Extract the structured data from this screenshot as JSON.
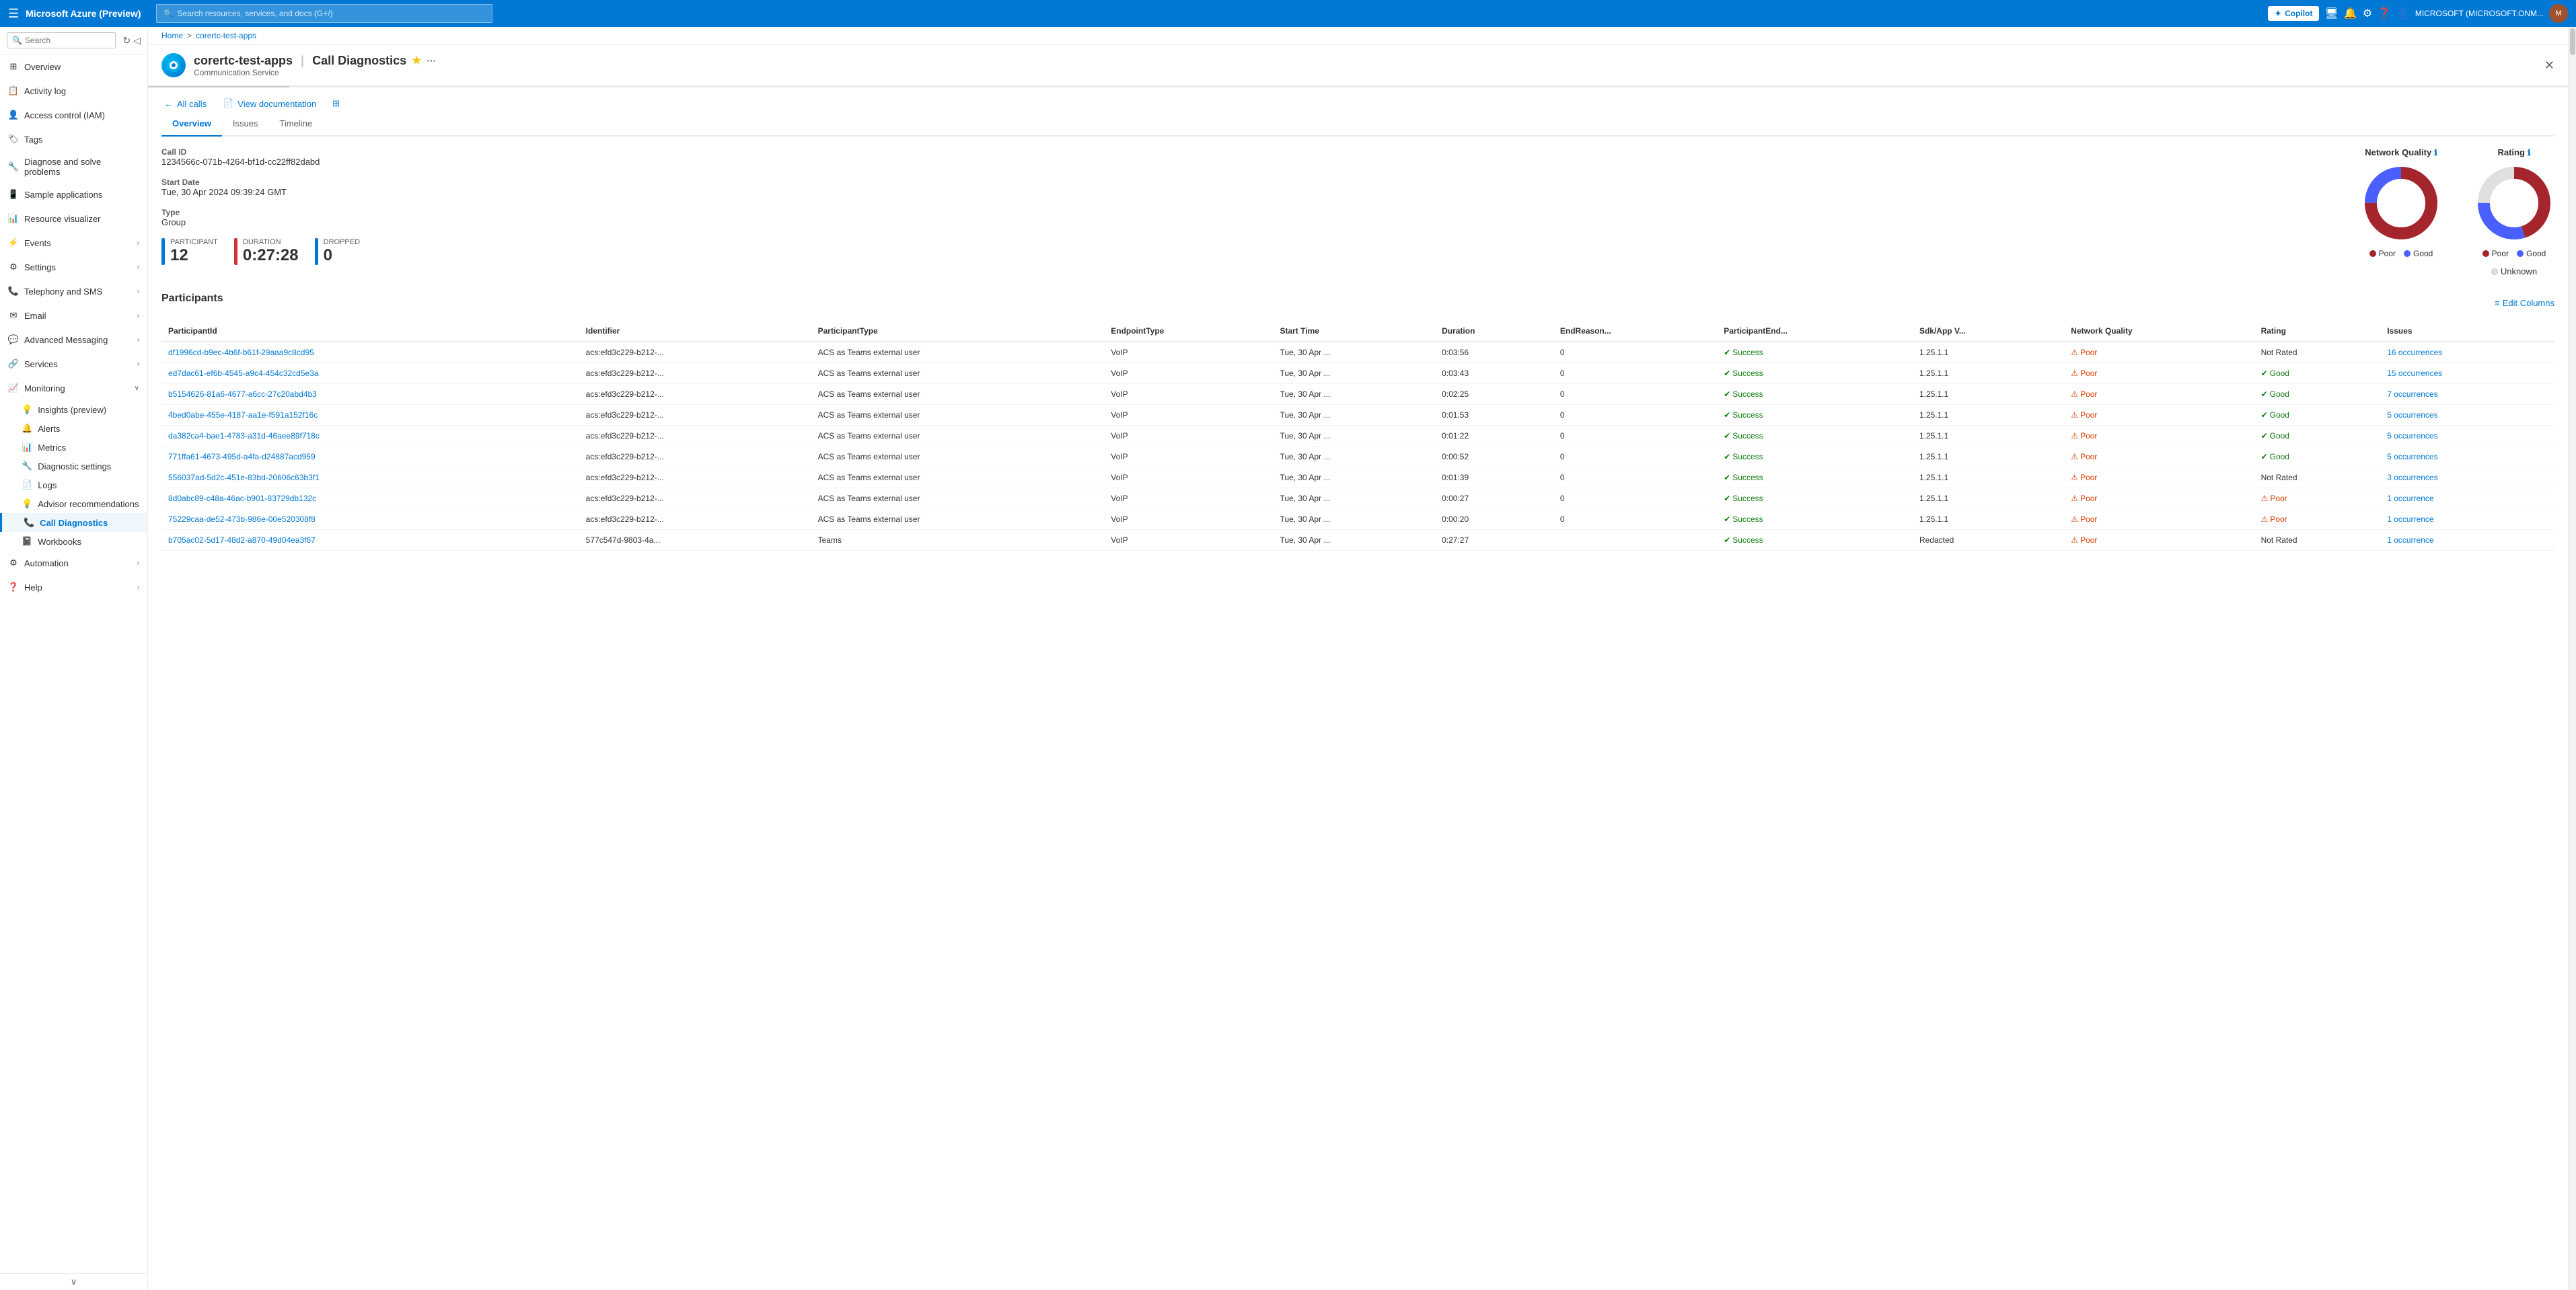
{
  "topNav": {
    "hamburger": "☰",
    "appTitle": "Microsoft Azure (Preview)",
    "searchPlaceholder": "Search resources, services, and docs (G+/)",
    "copilotLabel": "Copilot",
    "userText": "MICROSOFT (MICROSOFT.ONM...",
    "icons": [
      "monitor",
      "bell",
      "gear",
      "question",
      "person"
    ]
  },
  "breadcrumb": {
    "home": "Home",
    "separator": ">",
    "resource": "corertc-test-apps"
  },
  "resourceHeader": {
    "name": "corertc-test-apps",
    "separator": "|",
    "page": "Call Diagnostics",
    "subtitle": "Communication Service",
    "starIcon": "★",
    "moreIcon": "···"
  },
  "sidebar": {
    "searchPlaceholder": "Search",
    "items": [
      {
        "id": "overview",
        "label": "Overview",
        "icon": "⊞"
      },
      {
        "id": "activity-log",
        "label": "Activity log",
        "icon": "📋"
      },
      {
        "id": "access-control",
        "label": "Access control (IAM)",
        "icon": "👤"
      },
      {
        "id": "tags",
        "label": "Tags",
        "icon": "🏷"
      },
      {
        "id": "diagnose",
        "label": "Diagnose and solve problems",
        "icon": "🔧"
      },
      {
        "id": "sample-apps",
        "label": "Sample applications",
        "icon": "📱"
      },
      {
        "id": "resource-viz",
        "label": "Resource visualizer",
        "icon": "📊"
      },
      {
        "id": "events",
        "label": "Events",
        "icon": "⚡",
        "hasChevron": true
      },
      {
        "id": "settings",
        "label": "Settings",
        "icon": "⚙",
        "hasChevron": true
      },
      {
        "id": "telephony",
        "label": "Telephony and SMS",
        "icon": "📞",
        "hasChevron": true
      },
      {
        "id": "email",
        "label": "Email",
        "icon": "✉",
        "hasChevron": true
      },
      {
        "id": "advanced-messaging",
        "label": "Advanced Messaging",
        "icon": "💬",
        "hasChevron": true
      },
      {
        "id": "services",
        "label": "Services",
        "icon": "🔗",
        "hasChevron": true
      },
      {
        "id": "monitoring",
        "label": "Monitoring",
        "icon": "📈",
        "expanded": true
      },
      {
        "id": "insights",
        "label": "Insights (preview)",
        "icon": "💡",
        "indent": true
      },
      {
        "id": "alerts",
        "label": "Alerts",
        "icon": "🔔",
        "indent": true
      },
      {
        "id": "metrics",
        "label": "Metrics",
        "icon": "📊",
        "indent": true
      },
      {
        "id": "diagnostic-settings",
        "label": "Diagnostic settings",
        "icon": "🔧",
        "indent": true
      },
      {
        "id": "logs",
        "label": "Logs",
        "icon": "📄",
        "indent": true
      },
      {
        "id": "advisor",
        "label": "Advisor recommendations",
        "icon": "💡",
        "indent": true
      },
      {
        "id": "call-diagnostics",
        "label": "Call Diagnostics",
        "icon": "📞",
        "indent": true,
        "active": true
      },
      {
        "id": "workbooks",
        "label": "Workbooks",
        "icon": "📓",
        "indent": true
      },
      {
        "id": "automation",
        "label": "Automation",
        "icon": "⚙",
        "hasChevron": true
      },
      {
        "id": "help",
        "label": "Help",
        "icon": "❓",
        "hasChevron": true
      }
    ]
  },
  "toolbar": {
    "backLabel": "All calls",
    "docLabel": "View documentation",
    "gridIcon": "⊞"
  },
  "tabs": [
    {
      "id": "overview",
      "label": "Overview",
      "active": true
    },
    {
      "id": "issues",
      "label": "Issues"
    },
    {
      "id": "timeline",
      "label": "Timeline"
    }
  ],
  "callInfo": {
    "callIdLabel": "Call ID",
    "callIdValue": "1234566c-071b-4264-bf1d-cc22ff82dabd",
    "startDateLabel": "Start Date",
    "startDateValue": "Tue, 30 Apr 2024 09:39:24 GMT",
    "typeLabel": "Type",
    "typeValue": "Group"
  },
  "kpis": [
    {
      "id": "participant",
      "label": "Participant",
      "value": "12",
      "color": "#0078d4"
    },
    {
      "id": "duration",
      "label": "Duration",
      "value": "0:27:28",
      "color": "#d13438"
    },
    {
      "id": "dropped",
      "label": "Dropped",
      "value": "0",
      "color": "#0078d4"
    }
  ],
  "charts": {
    "networkQuality": {
      "title": "Network Quality",
      "poorValue": 75,
      "goodValue": 25,
      "poorColor": "#a4262c",
      "goodColor": "#4a5fff",
      "legend": [
        {
          "label": "Poor",
          "color": "#a4262c"
        },
        {
          "label": "Good",
          "color": "#4a5fff"
        }
      ]
    },
    "rating": {
      "title": "Rating",
      "poorValue": 45,
      "goodValue": 30,
      "unknownValue": 25,
      "poorColor": "#a4262c",
      "goodColor": "#4a5fff",
      "unknownColor": "#e0e0e0",
      "legend": [
        {
          "label": "Poor",
          "color": "#a4262c"
        },
        {
          "label": "Good",
          "color": "#4a5fff"
        },
        {
          "label": "Unknown",
          "color": "#e0e0e0"
        }
      ]
    }
  },
  "participants": {
    "sectionTitle": "Participants",
    "editColumnsLabel": "Edit Columns",
    "columns": [
      "ParticipantId",
      "Identifier",
      "ParticipantType",
      "EndpointType",
      "Start Time",
      "Duration",
      "EndReason...",
      "ParticipantEnd...",
      "Sdk/App V...",
      "Network Quality",
      "Rating",
      "Issues"
    ],
    "rows": [
      {
        "participantId": "df1996cd-b9ec-4b6f-b61f-29aaa9c8cd95",
        "identifier": "acs:efd3c229-b212-...",
        "participantType": "ACS as Teams external user",
        "endpointType": "VoIP",
        "startTime": "Tue, 30 Apr ...",
        "duration": "0:03:56",
        "endReason": "0",
        "participantEnd": "Success",
        "sdkAppV": "1.25.1.1",
        "networkQuality": "Poor",
        "rating": "Not Rated",
        "issues": "16 occurrences",
        "endSuccess": true,
        "networkPoor": true,
        "ratingNeutral": true
      },
      {
        "participantId": "ed7dac61-ef6b-4545-a9c4-454c32cd5e3a",
        "identifier": "acs:efd3c229-b212-...",
        "participantType": "ACS as Teams external user",
        "endpointType": "VoIP",
        "startTime": "Tue, 30 Apr ...",
        "duration": "0:03:43",
        "endReason": "0",
        "participantEnd": "Success",
        "sdkAppV": "1.25.1.1",
        "networkQuality": "Poor",
        "rating": "Good",
        "issues": "15 occurrences",
        "endSuccess": true,
        "networkPoor": true,
        "ratingGood": true
      },
      {
        "participantId": "b5154626-81a6-4677-a6cc-27c20abd4b3",
        "identifier": "acs:efd3c229-b212-...",
        "participantType": "ACS as Teams external user",
        "endpointType": "VoIP",
        "startTime": "Tue, 30 Apr ...",
        "duration": "0:02:25",
        "endReason": "0",
        "participantEnd": "Success",
        "sdkAppV": "1.25.1.1",
        "networkQuality": "Poor",
        "rating": "Good",
        "issues": "7 occurrences",
        "endSuccess": true,
        "networkPoor": true,
        "ratingGood": true
      },
      {
        "participantId": "4bed0abe-455e-4187-aa1e-f591a152f16c",
        "identifier": "acs:efd3c229-b212-...",
        "participantType": "ACS as Teams external user",
        "endpointType": "VoIP",
        "startTime": "Tue, 30 Apr ...",
        "duration": "0:01:53",
        "endReason": "0",
        "participantEnd": "Success",
        "sdkAppV": "1.25.1.1",
        "networkQuality": "Poor",
        "rating": "Good",
        "issues": "5 occurrences",
        "endSuccess": true,
        "networkPoor": true,
        "ratingGood": true
      },
      {
        "participantId": "da382ca4-bae1-4783-a31d-46aee89f718c",
        "identifier": "acs:efd3c229-b212-...",
        "participantType": "ACS as Teams external user",
        "endpointType": "VoIP",
        "startTime": "Tue, 30 Apr ...",
        "duration": "0:01:22",
        "endReason": "0",
        "participantEnd": "Success",
        "sdkAppV": "1.25.1.1",
        "networkQuality": "Poor",
        "rating": "Good",
        "issues": "5 occurrences",
        "endSuccess": true,
        "networkPoor": true,
        "ratingGood": true
      },
      {
        "participantId": "771ffa61-4673-495d-a4fa-d24887acd959",
        "identifier": "acs:efd3c229-b212-...",
        "participantType": "ACS as Teams external user",
        "endpointType": "VoIP",
        "startTime": "Tue, 30 Apr ...",
        "duration": "0:00:52",
        "endReason": "0",
        "participantEnd": "Success",
        "sdkAppV": "1.25.1.1",
        "networkQuality": "Poor",
        "rating": "Good",
        "issues": "5 occurrences",
        "endSuccess": true,
        "networkPoor": true,
        "ratingGood": true
      },
      {
        "participantId": "556037ad-5d2c-451e-83bd-20606c63b3f1",
        "identifier": "acs:efd3c229-b212-...",
        "participantType": "ACS as Teams external user",
        "endpointType": "VoIP",
        "startTime": "Tue, 30 Apr ...",
        "duration": "0:01:39",
        "endReason": "0",
        "participantEnd": "Success",
        "sdkAppV": "1.25.1.1",
        "networkQuality": "Poor",
        "rating": "Not Rated",
        "issues": "3 occurrences",
        "endSuccess": true,
        "networkPoor": true,
        "ratingNeutral": true
      },
      {
        "participantId": "8d0abc89-c48a-46ac-b901-83729db132c",
        "identifier": "acs:efd3c229-b212-...",
        "participantType": "ACS as Teams external user",
        "endpointType": "VoIP",
        "startTime": "Tue, 30 Apr ...",
        "duration": "0:00:27",
        "endReason": "0",
        "participantEnd": "Success",
        "sdkAppV": "1.25.1.1",
        "networkQuality": "Poor",
        "rating": "Poor",
        "issues": "1 occurrence",
        "endSuccess": true,
        "networkPoor": true,
        "ratingPoor": true
      },
      {
        "participantId": "75229caa-de52-473b-986e-00e520308f8",
        "identifier": "acs:efd3c229-b212-...",
        "participantType": "ACS as Teams external user",
        "endpointType": "VoIP",
        "startTime": "Tue, 30 Apr ...",
        "duration": "0:00:20",
        "endReason": "0",
        "participantEnd": "Success",
        "sdkAppV": "1.25.1.1",
        "networkQuality": "Poor",
        "rating": "Poor",
        "issues": "1 occurrence",
        "endSuccess": true,
        "networkPoor": true,
        "ratingPoor": true
      },
      {
        "participantId": "b705ac02-5d17-48d2-a870-49d04ea3f67",
        "identifier": "577c547d-9803-4a...",
        "participantType": "Teams",
        "endpointType": "VoIP",
        "startTime": "Tue, 30 Apr ...",
        "duration": "0:27:27",
        "endReason": "",
        "participantEnd": "Success",
        "sdkAppV": "Redacted",
        "networkQuality": "Poor",
        "rating": "Not Rated",
        "issues": "1 occurrence",
        "endSuccess": true,
        "networkPoor": true,
        "ratingNeutral": true
      }
    ]
  }
}
